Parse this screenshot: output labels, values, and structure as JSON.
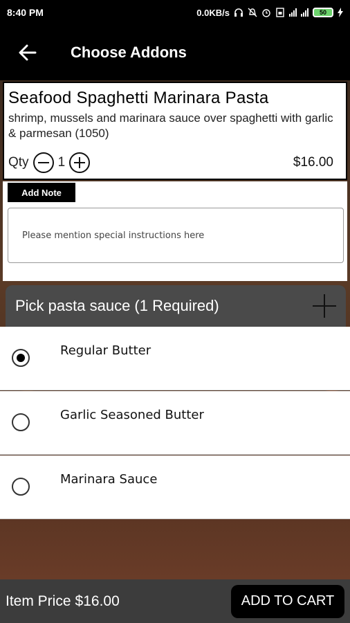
{
  "status_bar": {
    "time": "8:40 PM",
    "network_speed": "0.0KB/s",
    "battery_level": "50",
    "icons": [
      "headphones-icon",
      "mute-icon",
      "alarm-icon",
      "sim-icon",
      "signal-4g-icon",
      "signal-icon",
      "battery-icon",
      "charging-icon"
    ]
  },
  "app_bar": {
    "back_icon": "back-arrow-icon",
    "title": "Choose Addons"
  },
  "product": {
    "name": "Seafood Spaghetti Marinara Pasta",
    "description": "shrimp, mussels and marinara sauce over spaghetti with garlic & parmesan (1050)",
    "qty_label": "Qty",
    "qty": "1",
    "price": "$16.00"
  },
  "note": {
    "tag": "Add Note",
    "placeholder": "Please mention special instructions here"
  },
  "section": {
    "title": "Pick pasta sauce (1 Required)",
    "expand_icon": "plus-icon"
  },
  "options": [
    {
      "label": "Regular Butter",
      "selected": true
    },
    {
      "label": "Garlic Seasoned Butter",
      "selected": false
    },
    {
      "label": "Marinara Sauce",
      "selected": false
    }
  ],
  "footer": {
    "item_price_label": "Item Price",
    "item_price": "$16.00",
    "cart_button": "ADD TO CART"
  }
}
